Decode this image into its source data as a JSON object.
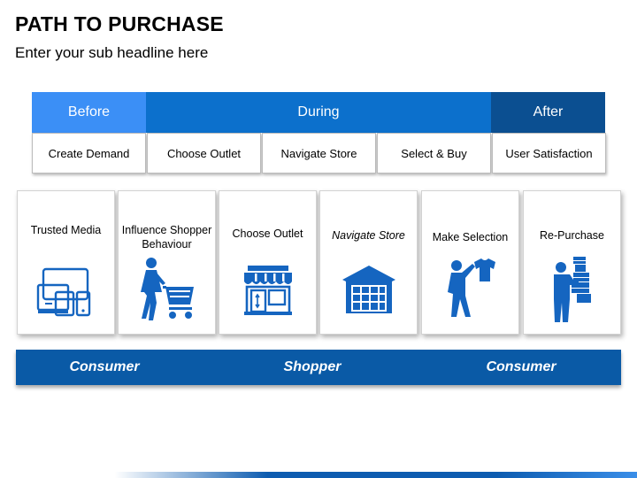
{
  "header": {
    "title": "PATH TO PURCHASE",
    "subtitle": "Enter your sub headline here"
  },
  "phases": [
    {
      "label": "Before",
      "color": "#3b8ff6"
    },
    {
      "label": "During",
      "color": "#0c70cc"
    },
    {
      "label": "After",
      "color": "#0b4f91"
    }
  ],
  "steps": [
    "Create Demand",
    "Choose Outlet",
    "Navigate Store",
    "Select & Buy",
    "User Satisfaction"
  ],
  "cards": [
    {
      "label": "Trusted Media",
      "icon": "devices-icon"
    },
    {
      "label": "Influence Shopper Behaviour",
      "icon": "shopper-cart-icon"
    },
    {
      "label": "Choose Outlet",
      "icon": "storefront-icon"
    },
    {
      "label": "Navigate Store",
      "icon": "warehouse-icon"
    },
    {
      "label": "Make Selection",
      "icon": "person-shirt-icon"
    },
    {
      "label": "Re-Purchase",
      "icon": "person-boxes-icon"
    }
  ],
  "band": {
    "labels": [
      "Consumer",
      "Shopper",
      "Consumer"
    ],
    "color": "#0a5aa6"
  },
  "icon_color": "#1565c0"
}
